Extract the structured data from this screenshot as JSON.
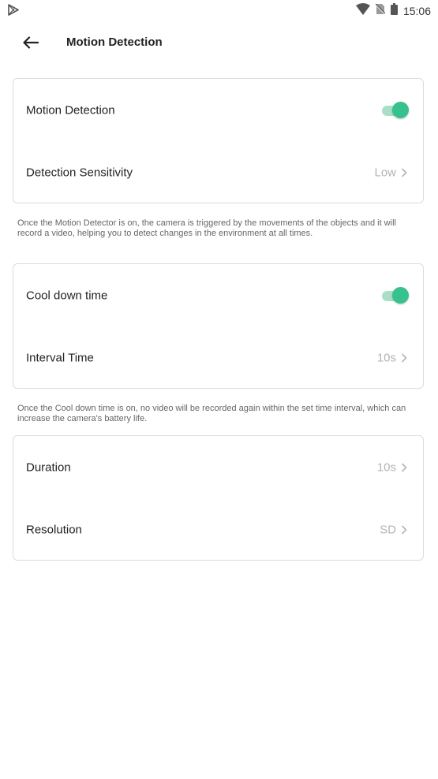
{
  "status_bar": {
    "time": "15:06",
    "icons": [
      "play-store-icon",
      "wifi-icon",
      "no-sim-icon",
      "battery-icon"
    ]
  },
  "header": {
    "back_icon": "back-arrow-icon",
    "title": "Motion Detection"
  },
  "colors": {
    "accent": "#37c18e",
    "accent_track": "#a9dfc9",
    "value_text": "#b4b4b4"
  },
  "motion_card": {
    "motion_detection": {
      "label": "Motion Detection",
      "enabled": true
    },
    "sensitivity": {
      "label": "Detection Sensitivity",
      "value": "Low"
    }
  },
  "motion_note": "Once the Motion Detector is on, the camera is triggered by the movements of the objects and it will record a video, helping you to detect changes in the environment at all times.",
  "cooldown_card": {
    "cool_down": {
      "label": "Cool down time",
      "enabled": true
    },
    "interval": {
      "label": "Interval Time",
      "value": "10s"
    }
  },
  "cooldown_note": "Once the Cool down time is on, no video will be recorded again within the set time interval, which can increase the camera's battery life.",
  "recording_card": {
    "duration": {
      "label": "Duration",
      "value": "10s"
    },
    "resolution": {
      "label": "Resolution",
      "value": "SD"
    }
  }
}
